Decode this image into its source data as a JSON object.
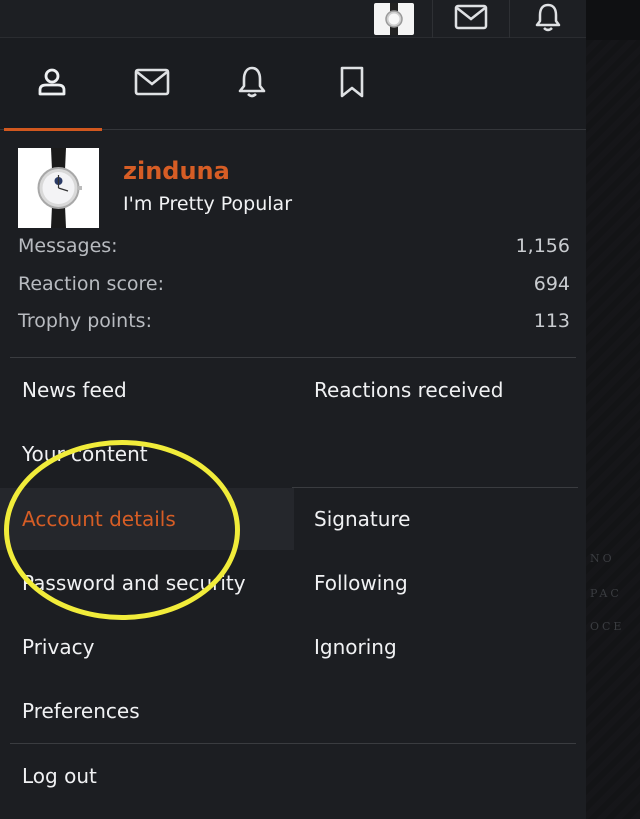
{
  "topbar": {
    "icons": [
      "avatar-thumb",
      "envelope-icon",
      "bell-icon"
    ]
  },
  "tabs": [
    {
      "icon": "user-icon",
      "active": true
    },
    {
      "icon": "envelope-icon",
      "active": false
    },
    {
      "icon": "bell-icon",
      "active": false
    },
    {
      "icon": "bookmark-icon",
      "active": false
    }
  ],
  "profile": {
    "username": "zinduna",
    "user_title": "I'm Pretty Popular",
    "stats": [
      {
        "label": "Messages:",
        "value": "1,156"
      },
      {
        "label": "Reaction score:",
        "value": "694"
      },
      {
        "label": "Trophy points:",
        "value": "113"
      }
    ]
  },
  "menu": {
    "news_feed": "News feed",
    "reactions_received": "Reactions received",
    "your_content": "Your content",
    "account_details": "Account details",
    "signature": "Signature",
    "password_security": "Password and security",
    "following": "Following",
    "privacy": "Privacy",
    "ignoring": "Ignoring",
    "preferences": "Preferences",
    "log_out": "Log out"
  },
  "colors": {
    "accent": "#d65d25",
    "highlight_ring": "#f1ec3a",
    "panel_bg": "#1c1e22"
  }
}
